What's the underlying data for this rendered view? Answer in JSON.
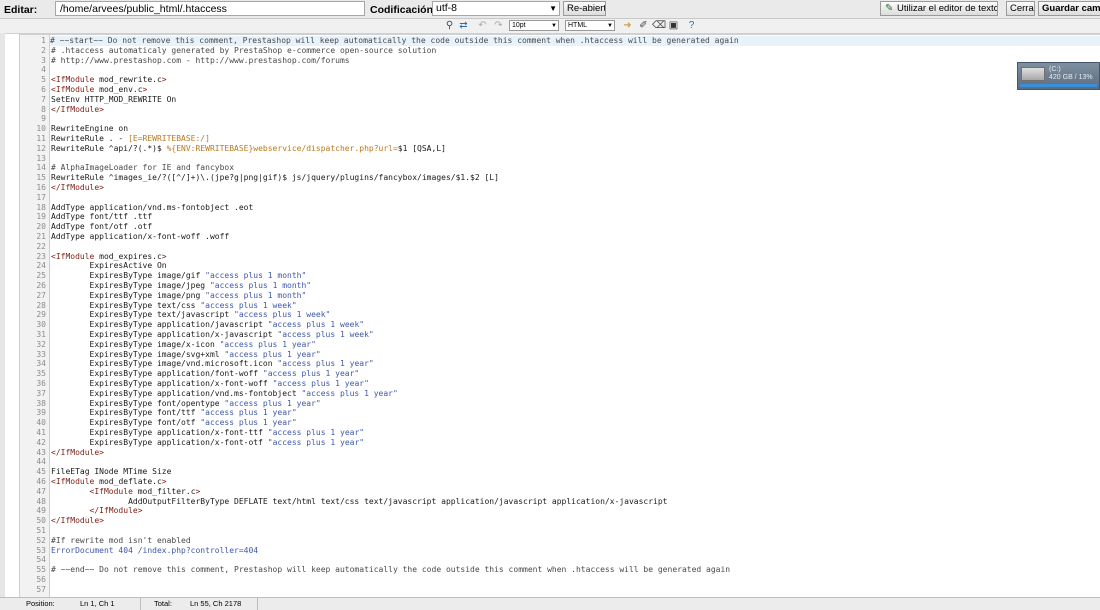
{
  "header": {
    "edit_label": "Editar:",
    "path_value": "/home/arvees/public_html/.htaccess",
    "encoding_label": "Codificación:",
    "encoding_value": "utf-8",
    "reopen_button": "Re-abierto",
    "text_editor_button": "Utilizar el editor de texto.",
    "close_button": "Cerrar",
    "save_button": "Guardar cambios"
  },
  "toolbar": {
    "font_size": "10pt",
    "syntax": "HTML",
    "icons": [
      "search-icon",
      "replace-icon",
      "undo-icon",
      "redo-icon",
      "font-size-select",
      "syntax-select",
      "go-to-line-icon",
      "highlight-icon",
      "reset-icon",
      "fullscreen-icon",
      "help-icon"
    ]
  },
  "editor": {
    "lines": [
      "# ~~start~~ Do not remove this comment, Prestashop will keep automatically the code outside this comment when .htaccess will be generated again",
      "# .htaccess automaticaly generated by PrestaShop e-commerce open-source solution",
      "# http://www.prestashop.com - http://www.prestashop.com/forums",
      "",
      "<IfModule mod_rewrite.c>",
      "<IfModule mod_env.c>",
      "SetEnv HTTP_MOD_REWRITE On",
      "</IfModule>",
      "",
      "RewriteEngine on",
      "RewriteRule . - [E=REWRITEBASE:/]",
      "RewriteRule ^api/?(.*)$ %{ENV:REWRITEBASE}webservice/dispatcher.php?url=$1 [QSA,L]",
      "",
      "# AlphaImageLoader for IE and fancybox",
      "RewriteRule ^images_ie/?([^/]+)\\.(jpe?g|png|gif)$ js/jquery/plugins/fancybox/images/$1.$2 [L]",
      "</IfModule>",
      "",
      "AddType application/vnd.ms-fontobject .eot",
      "AddType font/ttf .ttf",
      "AddType font/otf .otf",
      "AddType application/x-font-woff .woff",
      "",
      "<IfModule mod_expires.c>",
      "\tExpiresActive On",
      "\tExpiresByType image/gif \"access plus 1 month\"",
      "\tExpiresByType image/jpeg \"access plus 1 month\"",
      "\tExpiresByType image/png \"access plus 1 month\"",
      "\tExpiresByType text/css \"access plus 1 week\"",
      "\tExpiresByType text/javascript \"access plus 1 week\"",
      "\tExpiresByType application/javascript \"access plus 1 week\"",
      "\tExpiresByType application/x-javascript \"access plus 1 week\"",
      "\tExpiresByType image/x-icon \"access plus 1 year\"",
      "\tExpiresByType image/svg+xml \"access plus 1 year\"",
      "\tExpiresByType image/vnd.microsoft.icon \"access plus 1 year\"",
      "\tExpiresByType application/font-woff \"access plus 1 year\"",
      "\tExpiresByType application/x-font-woff \"access plus 1 year\"",
      "\tExpiresByType application/vnd.ms-fontobject \"access plus 1 year\"",
      "\tExpiresByType font/opentype \"access plus 1 year\"",
      "\tExpiresByType font/ttf \"access plus 1 year\"",
      "\tExpiresByType font/otf \"access plus 1 year\"",
      "\tExpiresByType application/x-font-ttf \"access plus 1 year\"",
      "\tExpiresByType application/x-font-otf \"access plus 1 year\"",
      "</IfModule>",
      "",
      "FileETag INode MTime Size",
      "<IfModule mod_deflate.c>",
      "\t<IfModule mod_filter.c>",
      "\t\tAddOutputFilterByType DEFLATE text/html text/css text/javascript application/javascript application/x-javascript",
      "\t</IfModule>",
      "</IfModule>",
      "",
      "#If rewrite mod isn't enabled",
      "ErrorDocument 404 /index.php?controller=404",
      "",
      "# ~~end~~ Do not remove this comment, Prestashop will keep automatically the code outside this comment when .htaccess will be generated again",
      "",
      ""
    ]
  },
  "statusbar": {
    "position_label": "Position:",
    "position_value": "Ln 1, Ch 1",
    "total_label": "Total:",
    "total_value": "Ln 55, Ch 2178"
  },
  "drive_widget": {
    "letter": "(C:)",
    "usage": "420 GB / 13%"
  },
  "colors": {
    "comment": "#4a4a4a",
    "tag": "#7b1e12",
    "string": "#3e58a8",
    "variable": "#b8791d",
    "highlight_line": "#e8f2fb"
  }
}
